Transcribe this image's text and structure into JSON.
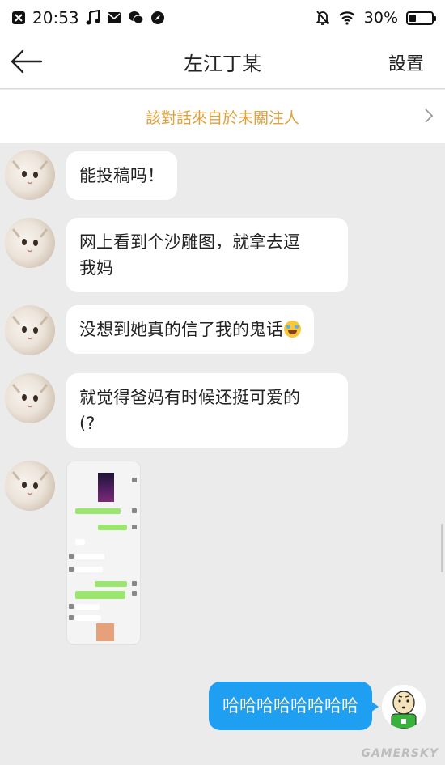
{
  "status_bar": {
    "time": "20:53",
    "battery": "30%",
    "battery_level": 0.3,
    "icons": [
      "close-box-icon",
      "music-note-icon",
      "mail-icon",
      "wechat-icon",
      "compass-icon",
      "mute-bell-icon",
      "wifi-icon",
      "battery-icon"
    ]
  },
  "header": {
    "title": "左江丁某",
    "settings_label": "設置",
    "back_icon": "arrow-left-icon"
  },
  "banner": {
    "text": "該對話來自於未關注人",
    "chevron_icon": "chevron-right-icon",
    "color": "#e0a13a"
  },
  "messages": [
    {
      "line1": "能投稿吗！"
    },
    {
      "line1": "网上看到个沙雕图，就拿去逗",
      "line2": "我妈"
    },
    {
      "line1": "没想到她真的信了我的鬼话",
      "emoji": "tears-of-joy-emoji"
    },
    {
      "line1": "就觉得爸妈有时候还挺可爱的",
      "line2": "(?"
    }
  ],
  "self_message": {
    "text": "哈哈哈哈哈哈哈哈",
    "color": "#1e9ff2"
  },
  "watermark": "GAMERSKY"
}
